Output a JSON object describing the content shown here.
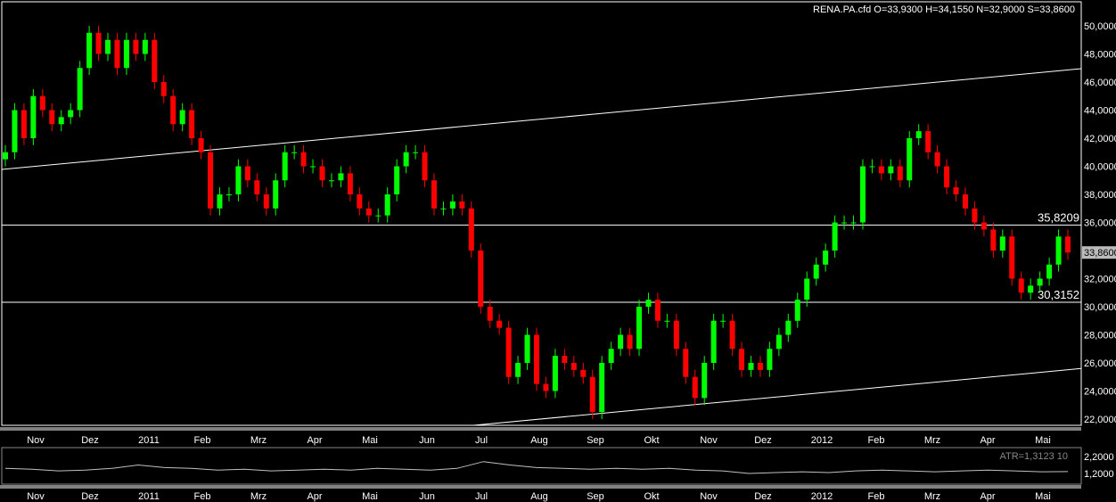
{
  "chart_data": [
    {
      "type": "candlestick",
      "title": "RENA.PA.cfd O=33,9300 H=34,1550 N=32,9000 S=33,8600",
      "ylim": [
        21,
        51.5
      ],
      "yticks": [
        "22,0000",
        "24,0000",
        "26,0000",
        "28,0000",
        "30,0000",
        "32,0000",
        "34,0000",
        "36,0000",
        "38,0000",
        "40,0000",
        "42,0000",
        "44,0000",
        "46,0000",
        "48,0000",
        "50,0000"
      ],
      "ytick_values": [
        22,
        24,
        26,
        28,
        30,
        32,
        34,
        36,
        38,
        40,
        42,
        44,
        46,
        48,
        50
      ],
      "last_price_label": "33,8600",
      "last_price": 33.86,
      "xticks": [
        "Nov",
        "Dez",
        "2011",
        "Feb",
        "Mrz",
        "Apr",
        "Mai",
        "Jun",
        "Jul",
        "Aug",
        "Sep",
        "Okt",
        "Nov",
        "Dez",
        "2012",
        "Feb",
        "Mrz",
        "Apr",
        "Mai"
      ],
      "closes": [
        41,
        44,
        42,
        45,
        44,
        43,
        43.5,
        44,
        47,
        49.5,
        48,
        49,
        47,
        49,
        48,
        49,
        46,
        45,
        43,
        44,
        42,
        41,
        37,
        38,
        38,
        40,
        39,
        38,
        37,
        39,
        41,
        41,
        40,
        40,
        39,
        39,
        39.5,
        38,
        37,
        36.5,
        36.5,
        38,
        40,
        41,
        41,
        39,
        37,
        37,
        37.5,
        37,
        34,
        30,
        29,
        28.5,
        25,
        26,
        28,
        24.5,
        24,
        26.5,
        26,
        25.5,
        25,
        22.5,
        26,
        27,
        28,
        27,
        30,
        30.5,
        29,
        29,
        27,
        25,
        23.5,
        26,
        29,
        29,
        27,
        25.5,
        26,
        25.5,
        27,
        28,
        29,
        30.5,
        32,
        33,
        34,
        36,
        36,
        36,
        40,
        40,
        39.5,
        40,
        39,
        42,
        42.5,
        41,
        40,
        38.5,
        38,
        37,
        36,
        35.5,
        34,
        35,
        32,
        31,
        31.5,
        32,
        33,
        35,
        33.86
      ],
      "up_color": "#00ff00",
      "down_color": "#ff0000",
      "horizontal_lines": [
        {
          "label": "35,8209",
          "value": 35.8209
        },
        {
          "label": "30,3152",
          "value": 30.3152
        }
      ],
      "trend_lines": [
        {
          "from": 39.78,
          "to": 46.95
        },
        {
          "from": 21.55,
          "to": 25.6
        }
      ]
    },
    {
      "type": "line",
      "legend": "ATR=1,3123  10",
      "yticks": [
        "2,2000",
        "1,2000"
      ],
      "ytick_values": [
        2.2,
        1.2
      ],
      "values": [
        1.5,
        1.45,
        1.35,
        1.4,
        1.5,
        1.7,
        1.55,
        1.5,
        1.4,
        1.45,
        1.35,
        1.4,
        1.45,
        1.4,
        1.5,
        1.45,
        1.4,
        1.5,
        1.9,
        1.7,
        1.55,
        1.5,
        1.45,
        1.5,
        1.45,
        1.5,
        1.4,
        1.35,
        1.2,
        1.25,
        1.3,
        1.25,
        1.35,
        1.4,
        1.35,
        1.3,
        1.35,
        1.4,
        1.35,
        1.3,
        1.31
      ],
      "color": "#c0c0c0"
    }
  ]
}
